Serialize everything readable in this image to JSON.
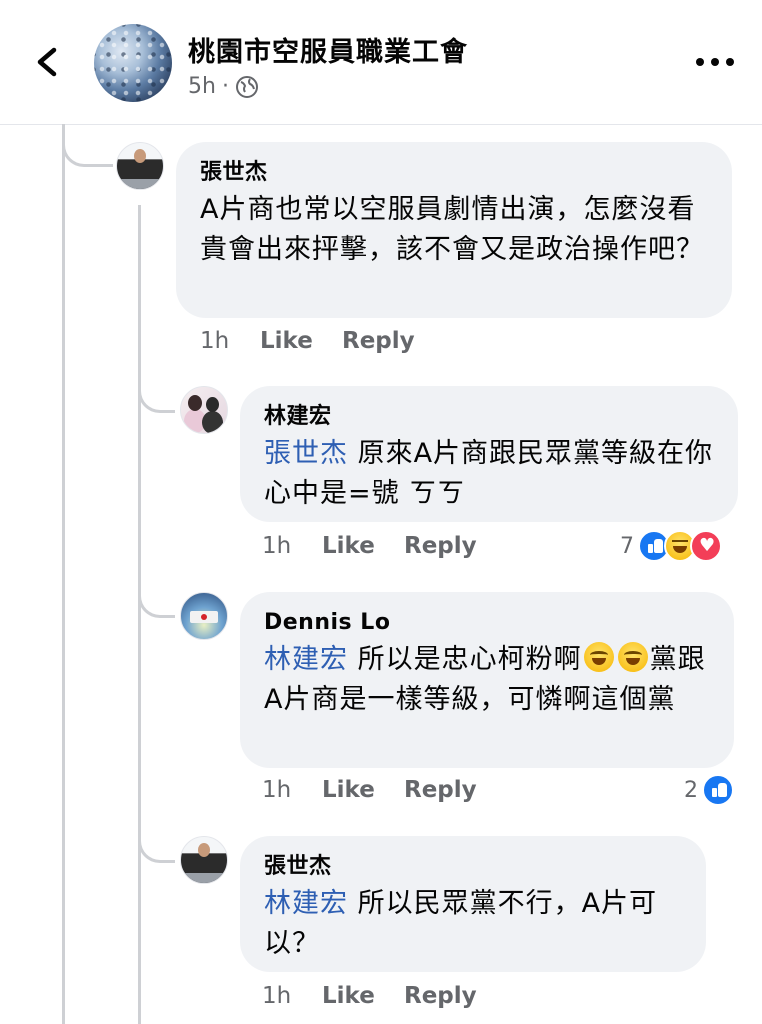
{
  "header": {
    "page_name": "桃園市空服員職業工會",
    "time": "5h",
    "separator": "·"
  },
  "comments": [
    {
      "author": "張世杰",
      "mention": "",
      "text": "A片商也常以空服員劇情出演，怎麼沒看貴會出來抨擊，該不會又是政治操作吧？",
      "time": "1h",
      "like_label": "Like",
      "reply_label": "Reply"
    },
    {
      "author": "林建宏",
      "mention": "張世杰",
      "text": " 原來A片商跟民眾黨等級在你心中是=號 ㄎㄎ",
      "time": "1h",
      "like_label": "Like",
      "reply_label": "Reply",
      "reaction_count": "7",
      "reactions": [
        "like",
        "haha",
        "love"
      ]
    },
    {
      "author": "Dennis Lo",
      "mention": "林建宏",
      "text_before": " 所以是忠心柯粉啊",
      "text_after": "黨跟A片商是一樣等級，可憐啊這個黨",
      "emoji": "tears-of-joy",
      "time": "1h",
      "like_label": "Like",
      "reply_label": "Reply",
      "reaction_count": "2",
      "reactions": [
        "like"
      ]
    },
    {
      "author": "張世杰",
      "mention": "林建宏",
      "text": " 所以民眾黨不行，A片可以？",
      "time": "1h",
      "like_label": "Like",
      "reply_label": "Reply"
    }
  ],
  "colors": {
    "mention": "#2e5fb3",
    "bubble": "#f0f2f5",
    "meta_text": "#65676b",
    "like_blue": "#1877f2",
    "love_red": "#f33e58"
  }
}
